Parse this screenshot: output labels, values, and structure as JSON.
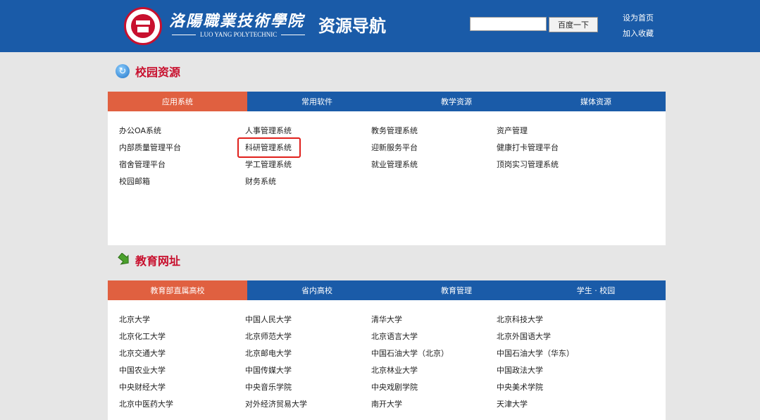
{
  "header": {
    "brand_cn": "洛陽職業技術學院",
    "brand_en": "LUO YANG POLYTECHNIC",
    "site_title": "资源导航",
    "search_placeholder": "",
    "search_button": "百度一下",
    "set_homepage": "设为首页",
    "add_favorite": "加入收藏",
    "logo_icon": "college-seal-icon"
  },
  "campus": {
    "heading": "校园资源",
    "heading_icon": "refresh-icon",
    "tabs": [
      {
        "label": "应用系统",
        "active": true
      },
      {
        "label": "常用软件",
        "active": false
      },
      {
        "label": "教学资源",
        "active": false
      },
      {
        "label": "媒体资源",
        "active": false
      }
    ],
    "links": [
      "办公OA系统",
      "人事管理系统",
      "教务管理系统",
      "资产管理",
      "内部质量管理平台",
      "科研管理系统",
      "迎新服务平台",
      "健康打卡管理平台",
      "宿舍管理平台",
      "学工管理系统",
      "就业管理系统",
      "顶岗实习管理系统",
      "校园邮箱",
      "财务系统"
    ],
    "highlighted_link": "科研管理系统"
  },
  "education": {
    "heading": "教育网址",
    "heading_icon": "green-arrow-icon",
    "tabs": [
      {
        "label": "教育部直属高校",
        "active": true
      },
      {
        "label": "省内高校",
        "active": false
      },
      {
        "label": "教育管理",
        "active": false
      },
      {
        "label": "学生 · 校园",
        "active": false
      }
    ],
    "links": [
      "北京大学",
      "中国人民大学",
      "清华大学",
      "北京科技大学",
      "北京化工大学",
      "北京师范大学",
      "北京语言大学",
      "北京外国语大学",
      "北京交通大学",
      "北京邮电大学",
      "中国石油大学（北京）",
      "中国石油大学（华东）",
      "中国农业大学",
      "中国传媒大学",
      "北京林业大学",
      "中国政法大学",
      "中央财经大学",
      "中央音乐学院",
      "中央戏剧学院",
      "中央美术学院",
      "北京中医药大学",
      "对外经济贸易大学",
      "南开大学",
      "天津大学"
    ]
  },
  "colors": {
    "header_blue": "#1a5ba8",
    "active_tab": "#e06040",
    "heading_red": "#c8102e",
    "highlight_red": "#e0201c"
  }
}
